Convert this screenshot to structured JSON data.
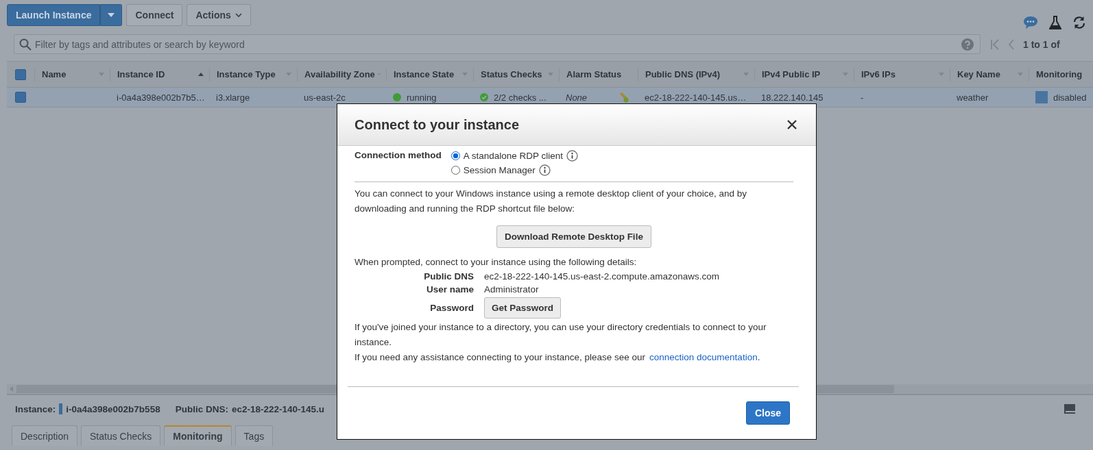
{
  "toolbar": {
    "buttons": [
      {
        "label": "Launch Instance",
        "kind": "split"
      },
      {
        "label": "Connect",
        "kind": "plain"
      },
      {
        "label": "Actions",
        "kind": "dropdown"
      }
    ]
  },
  "search": {
    "placeholder": "Filter by tags and attributes or search by keyword"
  },
  "pagination": {
    "text": "1 to 1 of"
  },
  "table": {
    "select_all": {
      "checked": true
    },
    "columns": [
      {
        "label": "Name",
        "sorted": false,
        "menu": true
      },
      {
        "label": "Instance ID",
        "sorted": true,
        "menu": false
      },
      {
        "label": "Instance Type",
        "sorted": false,
        "menu": true
      },
      {
        "label": "Availability Zone",
        "sorted": false,
        "menu": true
      },
      {
        "label": "Instance State",
        "sorted": false,
        "menu": true
      },
      {
        "label": "Status Checks",
        "sorted": false,
        "menu": true
      },
      {
        "label": "Alarm Status",
        "sorted": false,
        "menu": false
      },
      {
        "label": "Public DNS (IPv4)",
        "sorted": false,
        "menu": true
      },
      {
        "label": "IPv4 Public IP",
        "sorted": false,
        "menu": true
      },
      {
        "label": "IPv6 IPs",
        "sorted": false,
        "menu": true
      },
      {
        "label": "Key Name",
        "sorted": false,
        "menu": true
      },
      {
        "label": "Monitoring",
        "sorted": false,
        "menu": false
      }
    ],
    "rows": [
      {
        "selected": true,
        "checked": true,
        "cells": [
          {
            "kind": "text",
            "text": ""
          },
          {
            "kind": "text",
            "text": "i-0a4a398e002b7b5…"
          },
          {
            "kind": "text",
            "text": "i3.xlarge"
          },
          {
            "kind": "text",
            "text": "us-east-2c"
          },
          {
            "kind": "state",
            "text": "running",
            "color": "#3f9c35"
          },
          {
            "kind": "check",
            "text": "2/2 checks ..."
          },
          {
            "kind": "alarm",
            "text": "None"
          },
          {
            "kind": "text",
            "text": "ec2-18-222-140-145.us…"
          },
          {
            "kind": "text",
            "text": "18.222.140.145"
          },
          {
            "kind": "text",
            "text": "-"
          },
          {
            "kind": "text",
            "text": "weather"
          },
          {
            "kind": "monitor",
            "text": "disabled"
          }
        ]
      }
    ]
  },
  "details": [
    {
      "label": "Instance:",
      "value": "i-0a4a398e002b7b558",
      "marker": true
    },
    {
      "label": "Public DNS:",
      "value": "ec2-18-222-140-145.u",
      "marker": false
    }
  ],
  "detail_tabs": [
    {
      "label": "Description",
      "selected": false
    },
    {
      "label": "Status Checks",
      "selected": false
    },
    {
      "label": "Monitoring",
      "selected": true
    },
    {
      "label": "Tags",
      "selected": false
    }
  ],
  "dialog": {
    "title": "Connect to your instance",
    "method_label": "Connection method",
    "methods": [
      {
        "label": "A standalone RDP client",
        "selected": true
      },
      {
        "label": "Session Manager",
        "selected": false
      }
    ],
    "intro": "You can connect to your Windows instance using a remote desktop client of your choice, and by downloading and running the RDP shortcut file below:",
    "download_button": "Download Remote Desktop File",
    "prompt": "When prompted, connect to your instance using the following details:",
    "fields": [
      {
        "label": "Public DNS",
        "kind": "text",
        "value": "ec2-18-222-140-145.us-east-2.compute.amazonaws.com"
      },
      {
        "label": "User name",
        "kind": "text",
        "value": "Administrator"
      },
      {
        "label": "Password",
        "kind": "button",
        "value": "Get Password"
      }
    ],
    "directory_note": "If you've joined your instance to a directory, you can use your directory credentials to connect to your instance.",
    "help_text": "If you need any assistance connecting to your instance, please see our",
    "help_link": "connection documentation",
    "help_end": ".",
    "close_button": "Close"
  }
}
